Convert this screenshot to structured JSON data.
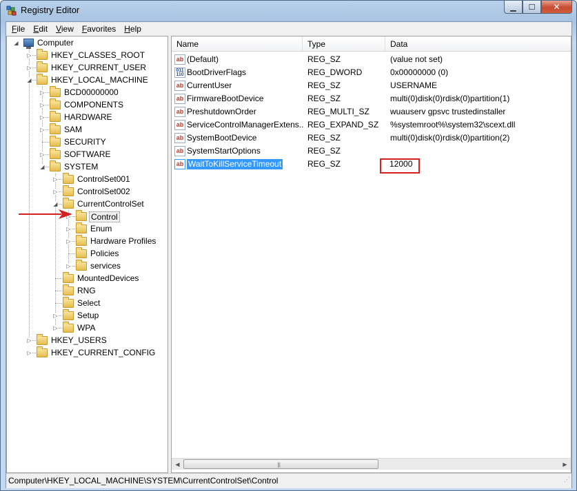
{
  "window": {
    "title": "Registry Editor",
    "buttons": {
      "minimize": "▁",
      "maximize": "☐",
      "close": "✕"
    }
  },
  "menu": [
    {
      "label": "File",
      "key": "F",
      "rest": "ile"
    },
    {
      "label": "Edit",
      "key": "E",
      "rest": "dit"
    },
    {
      "label": "View",
      "key": "V",
      "rest": "iew"
    },
    {
      "label": "Favorites",
      "key": "F",
      "rest": "avorites"
    },
    {
      "label": "Help",
      "key": "H",
      "rest": "elp"
    }
  ],
  "tree": {
    "root": "Computer",
    "nodes": [
      {
        "label": "HKEY_CLASSES_ROOT",
        "level": 1,
        "expander": "collapsed"
      },
      {
        "label": "HKEY_CURRENT_USER",
        "level": 1,
        "expander": "collapsed"
      },
      {
        "label": "HKEY_LOCAL_MACHINE",
        "level": 1,
        "expander": "expanded"
      },
      {
        "label": "BCD00000000",
        "level": 2,
        "expander": "collapsed"
      },
      {
        "label": "COMPONENTS",
        "level": 2,
        "expander": "collapsed"
      },
      {
        "label": "HARDWARE",
        "level": 2,
        "expander": "collapsed"
      },
      {
        "label": "SAM",
        "level": 2,
        "expander": "collapsed"
      },
      {
        "label": "SECURITY",
        "level": 2,
        "expander": "none"
      },
      {
        "label": "SOFTWARE",
        "level": 2,
        "expander": "collapsed"
      },
      {
        "label": "SYSTEM",
        "level": 2,
        "expander": "expanded"
      },
      {
        "label": "ControlSet001",
        "level": 3,
        "expander": "collapsed"
      },
      {
        "label": "ControlSet002",
        "level": 3,
        "expander": "collapsed"
      },
      {
        "label": "CurrentControlSet",
        "level": 3,
        "expander": "expanded"
      },
      {
        "label": "Control",
        "level": 4,
        "expander": "collapsed",
        "selected": true
      },
      {
        "label": "Enum",
        "level": 4,
        "expander": "collapsed"
      },
      {
        "label": "Hardware Profiles",
        "level": 4,
        "expander": "collapsed"
      },
      {
        "label": "Policies",
        "level": 4,
        "expander": "none"
      },
      {
        "label": "services",
        "level": 4,
        "expander": "collapsed"
      },
      {
        "label": "MountedDevices",
        "level": 3,
        "expander": "none"
      },
      {
        "label": "RNG",
        "level": 3,
        "expander": "none"
      },
      {
        "label": "Select",
        "level": 3,
        "expander": "none"
      },
      {
        "label": "Setup",
        "level": 3,
        "expander": "collapsed"
      },
      {
        "label": "WPA",
        "level": 3,
        "expander": "collapsed"
      },
      {
        "label": "HKEY_USERS",
        "level": 1,
        "expander": "collapsed"
      },
      {
        "label": "HKEY_CURRENT_CONFIG",
        "level": 1,
        "expander": "collapsed"
      }
    ]
  },
  "list": {
    "columns": [
      "Name",
      "Type",
      "Data"
    ],
    "rows": [
      {
        "icon": "string-value-icon",
        "glyph": "ab",
        "name": "(Default)",
        "type": "REG_SZ",
        "data": "(value not set)"
      },
      {
        "icon": "binary-value-icon",
        "glyph": "011 110",
        "name": "BootDriverFlags",
        "type": "REG_DWORD",
        "data": "0x00000000 (0)"
      },
      {
        "icon": "string-value-icon",
        "glyph": "ab",
        "name": "CurrentUser",
        "type": "REG_SZ",
        "data": "USERNAME"
      },
      {
        "icon": "string-value-icon",
        "glyph": "ab",
        "name": "FirmwareBootDevice",
        "type": "REG_SZ",
        "data": "multi(0)disk(0)rdisk(0)partition(1)"
      },
      {
        "icon": "string-value-icon",
        "glyph": "ab",
        "name": "PreshutdownOrder",
        "type": "REG_MULTI_SZ",
        "data": "wuauserv gpsvc trustedinstaller"
      },
      {
        "icon": "string-value-icon",
        "glyph": "ab",
        "name": "ServiceControlManagerExtens...",
        "type": "REG_EXPAND_SZ",
        "data": "%systemroot%\\system32\\scext.dll"
      },
      {
        "icon": "string-value-icon",
        "glyph": "ab",
        "name": "SystemBootDevice",
        "type": "REG_SZ",
        "data": "multi(0)disk(0)rdisk(0)partition(2)"
      },
      {
        "icon": "string-value-icon",
        "glyph": "ab",
        "name": "SystemStartOptions",
        "type": "REG_SZ",
        "data": ""
      },
      {
        "icon": "string-value-icon",
        "glyph": "ab",
        "name": "WaitToKillServiceTimeout",
        "type": "REG_SZ",
        "data": "12000",
        "selected": true
      }
    ]
  },
  "status": {
    "path": "Computer\\HKEY_LOCAL_MACHINE\\SYSTEM\\CurrentControlSet\\Control"
  },
  "colors": {
    "selection": "#3399ff",
    "annotation": "#d42020"
  }
}
